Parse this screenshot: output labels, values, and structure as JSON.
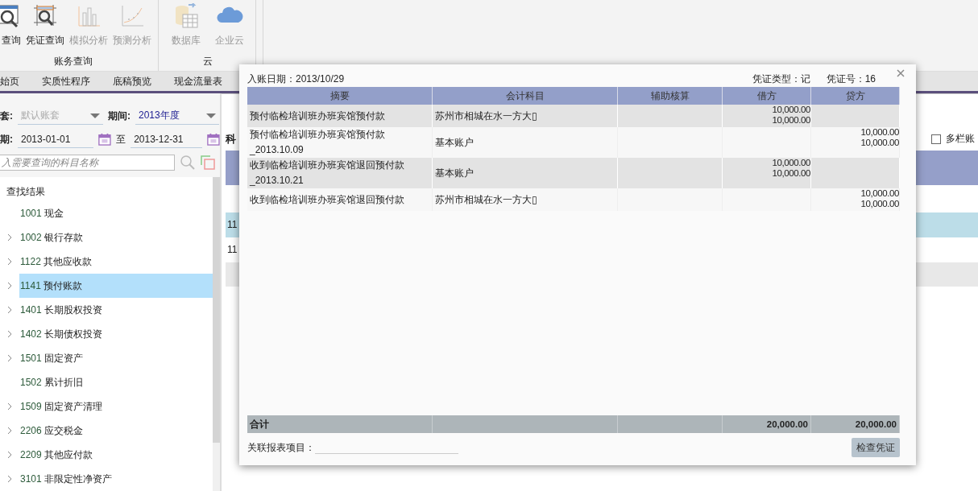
{
  "ribbon": {
    "groups": [
      {
        "label": "账务查询",
        "buttons": [
          {
            "label": "查询",
            "disabled": false
          },
          {
            "label": "凭证查询",
            "disabled": false
          },
          {
            "label": "模拟分析",
            "disabled": true
          },
          {
            "label": "预测分析",
            "disabled": true
          }
        ]
      },
      {
        "label": "云",
        "buttons": [
          {
            "label": "数据库",
            "disabled": true
          },
          {
            "label": "企业云",
            "disabled": true
          }
        ]
      }
    ]
  },
  "tabs": [
    {
      "label": "始页",
      "selected": false
    },
    {
      "label": "实质性程序",
      "selected": false
    },
    {
      "label": "底稿预览",
      "selected": false
    },
    {
      "label": "现金流量表",
      "selected": false
    }
  ],
  "filters": {
    "set_label": "套:",
    "set_value": "默认账套",
    "period_label": "期间:",
    "period_value": "2013年度",
    "date_label": "期:",
    "start_date": "2013-01-01",
    "to_label": "至",
    "end_date": "2013-12-31",
    "search_placeholder": "入需要查询的科目名称"
  },
  "tree": {
    "label": "查找结果",
    "children": [
      {
        "code": "1001",
        "name": "现金",
        "expandable": false,
        "selected": false
      },
      {
        "code": "1002",
        "name": "银行存款",
        "expandable": true,
        "selected": false
      },
      {
        "code": "1122",
        "name": "其他应收款",
        "expandable": true,
        "selected": false
      },
      {
        "code": "1141",
        "name": "预付账款",
        "expandable": true,
        "selected": true
      },
      {
        "code": "1401",
        "name": "长期股权投资",
        "expandable": true,
        "selected": false
      },
      {
        "code": "1402",
        "name": "长期债权投资",
        "expandable": true,
        "selected": false
      },
      {
        "code": "1501",
        "name": "固定资产",
        "expandable": true,
        "selected": false
      },
      {
        "code": "1502",
        "name": "累计折旧",
        "expandable": false,
        "selected": false
      },
      {
        "code": "1509",
        "name": "固定资产清理",
        "expandable": true,
        "selected": false
      },
      {
        "code": "2206",
        "name": "应交税金",
        "expandable": true,
        "selected": false
      },
      {
        "code": "2209",
        "name": "其他应付款",
        "expandable": true,
        "selected": false
      },
      {
        "code": "3101",
        "name": "非限定性净资产",
        "expandable": true,
        "selected": false
      }
    ]
  },
  "ledger": {
    "heading": "科",
    "multi_column": {
      "label": "多栏账",
      "checked": false
    },
    "rows": [
      {
        "text": "11",
        "selected": true
      },
      {
        "text": "11",
        "selected": false
      }
    ]
  },
  "dialog": {
    "date_label": "入账日期：2013/10/29",
    "type_label": "凭证类型：记",
    "number_label": "凭证号：16",
    "columns": [
      "摘要",
      "会计科目",
      "辅助核算",
      "借方",
      "贷方"
    ],
    "rows": [
      {
        "summary": "预付临检培训班办班宾馆预付款",
        "account": "苏州市相城在水一方大▯",
        "debit": [
          "10,000.00",
          "10,000.00"
        ]
      },
      {
        "summary": "预付临检培训班办班宾馆预付款_2013.10.09",
        "account": "基本账户",
        "credit": [
          "10,000.00",
          "10,000.00"
        ]
      },
      {
        "summary": "收到临检培训班办班宾馆退回预付款_2013.10.21",
        "account": "基本账户",
        "debit": [
          "10,000.00",
          "10,000.00"
        ]
      },
      {
        "summary": "收到临检培训班办班宾馆退回预付款",
        "account": "苏州市相城在水一方大▯",
        "credit": [
          "10,000.00",
          "10,000.00"
        ]
      }
    ],
    "total": {
      "label": "合计",
      "debit": "20,000.00",
      "credit": "20,000.00"
    },
    "link_label": "关联报表项目：",
    "button": "检查凭证"
  }
}
